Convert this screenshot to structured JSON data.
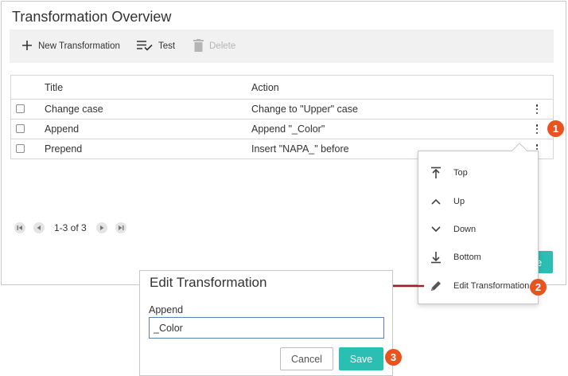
{
  "panel": {
    "title": "Transformation Overview"
  },
  "toolbar": {
    "new_label": "New Transformation",
    "test_label": "Test",
    "delete_label": "Delete"
  },
  "grid": {
    "columns": [
      "Title",
      "Action"
    ],
    "rows": [
      {
        "title": "Change case",
        "action": "Change to \"Upper\" case"
      },
      {
        "title": "Append",
        "action": "Append \"_Color\""
      },
      {
        "title": "Prepend",
        "action": "Insert \"NAPA_\" before"
      }
    ]
  },
  "pager": {
    "text": "1-3 of 3"
  },
  "teal_peek": "e",
  "context_menu": {
    "items": [
      {
        "label": "Top",
        "icon": "arrow-to-top-icon"
      },
      {
        "label": "Up",
        "icon": "chevron-up-icon"
      },
      {
        "label": "Down",
        "icon": "chevron-down-icon"
      },
      {
        "label": "Bottom",
        "icon": "arrow-to-bottom-icon"
      },
      {
        "label": "Edit Transformation",
        "icon": "pencil-icon"
      }
    ]
  },
  "badges": [
    "1",
    "2",
    "3"
  ],
  "dialog": {
    "title": "Edit Transformation",
    "field_label": "Append",
    "field_value": "_Color",
    "cancel_label": "Cancel",
    "save_label": "Save"
  },
  "colors": {
    "accent": "#2bbfb3",
    "badge": "#e8541f",
    "arrow": "#a32020"
  }
}
